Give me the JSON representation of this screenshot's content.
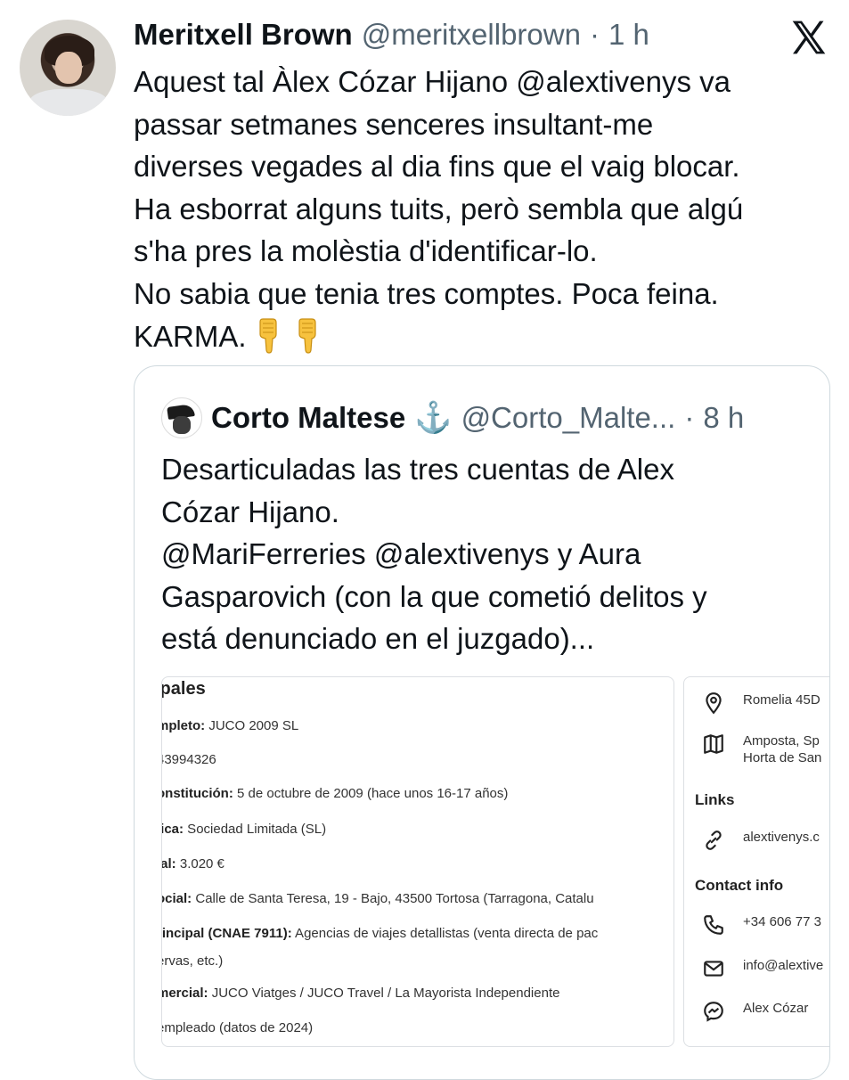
{
  "tweet": {
    "author_name": "Meritxell Brown",
    "author_handle": "@meritxellbrown",
    "separator": "·",
    "time": "1 h",
    "text": "Aquest tal Àlex Cózar Hijano @alextivenys va\npassar setmanes senceres insultant-me\ndiverses vegades al dia fins que el vaig blocar.\nHa esborrat alguns tuits, però sembla que algú\ns'ha pres la molèstia d'identificar-lo.\nNo sabia que tenia tres comptes. Poca feina.\nKARMA. ",
    "emojis": [
      "backhand-index-pointing-down",
      "backhand-index-pointing-down"
    ]
  },
  "quote": {
    "author_name": "Corto Maltese",
    "anchor": "⚓",
    "author_handle": "@Corto_Malte...",
    "separator": "·",
    "time": "8 h",
    "text": "Desarticuladas las tres cuentas de Alex\nCózar Hijano.\n@MariFerreries @alextivenys y Aura\nGasparovich (con la que cometió delitos y\nestá denunciado en el juzgado)..."
  },
  "screenshot_left": {
    "title": "ipales",
    "rows": [
      {
        "label": "mpleto:",
        "value": " JUCO 2009 SL"
      },
      {
        "label": "",
        "value": "43994326"
      },
      {
        "label": "onstitución:",
        "value": " 5 de octubre de 2009 (hace unos 16-17 años)"
      },
      {
        "label": "lica:",
        "value": " Sociedad Limitada (SL)"
      },
      {
        "label": "ial:",
        "value": " 3.020 €"
      },
      {
        "label": "ocial:",
        "value": " Calle de Santa Teresa, 19 - Bajo, 43500 Tortosa (Tarragona, Catalu"
      },
      {
        "label": "rincipal (CNAE 7911):",
        "value": " Agencias de viajes detallistas (venta directa de pac"
      },
      {
        "label": "",
        "value": "ervas, etc.)"
      },
      {
        "label": "mercial:",
        "value": " JUCO Viatges / JUCO Travel / La Mayorista Independiente"
      },
      {
        "label": "",
        "value": "empleado (datos de 2024)"
      }
    ]
  },
  "screenshot_right": {
    "address1": "Romelia 45D",
    "address2_line1": "Amposta, Sp",
    "address2_line2": "Horta de San",
    "links_heading": "Links",
    "link": "alextivenys.c",
    "contact_heading": "Contact info",
    "phone": "+34 606 77 3",
    "email": "info@alextive",
    "messenger": "Alex Cózar"
  },
  "icons": {
    "x_logo": "x-logo-icon",
    "emoji": "pointing-down-emoji-icon",
    "location": "location-pin-icon",
    "map": "map-icon",
    "link": "link-icon",
    "phone": "phone-icon",
    "email": "envelope-icon",
    "messenger": "messenger-icon"
  }
}
